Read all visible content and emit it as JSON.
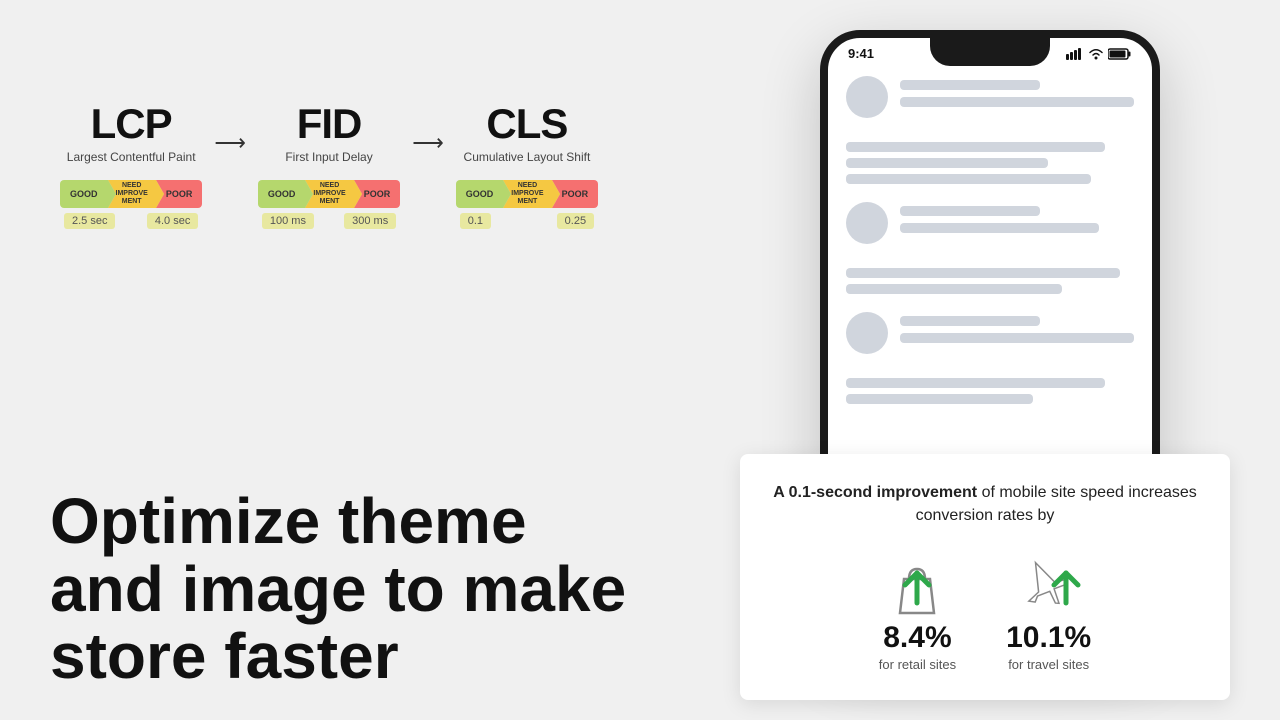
{
  "cwv": {
    "metrics": [
      {
        "abbr": "LCP",
        "name": "Largest Contentful Paint",
        "ratings": [
          "GOOD",
          "NEED\nIMPROVEMENT",
          "POOR"
        ],
        "thresholds": [
          "2.5 sec",
          "4.0 sec"
        ]
      },
      {
        "abbr": "FID",
        "name": "First Input Delay",
        "ratings": [
          "GOOD",
          "NEED\nIMPROVEMENT",
          "POOR"
        ],
        "thresholds": [
          "100 ms",
          "300 ms"
        ]
      },
      {
        "abbr": "CLS",
        "name": "Cumulative Layout Shift",
        "ratings": [
          "GOOD",
          "NEED\nIMPROVEMENT",
          "POOR"
        ],
        "thresholds": [
          "0.1",
          "0.25"
        ]
      }
    ]
  },
  "headline": "Optimize theme and image to make store faster",
  "phone": {
    "time": "9:41"
  },
  "info_card": {
    "title_normal": "of mobile site speed increases conversion rates by",
    "title_bold": "A 0.1-second improvement",
    "stats": [
      {
        "number": "8.4%",
        "label": "for retail sites",
        "icon": "shopping-bag"
      },
      {
        "number": "10.1%",
        "label": "for travel sites",
        "icon": "airplane"
      }
    ]
  }
}
